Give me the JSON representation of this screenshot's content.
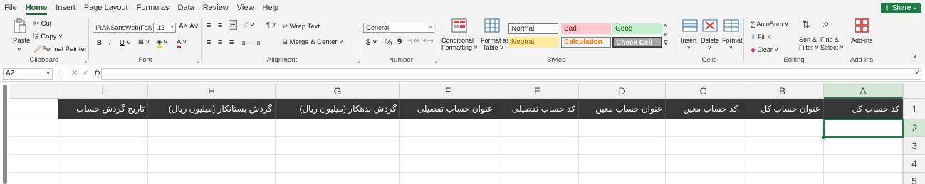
{
  "menu": {
    "items": [
      "File",
      "Home",
      "Insert",
      "Page Layout",
      "Formulas",
      "Data",
      "Review",
      "View",
      "Help"
    ],
    "active": "Home",
    "share_label": "Share"
  },
  "clipboard": {
    "paste": "Paste",
    "cut": "Cut",
    "copy": "Copy",
    "format_painter": "Format Painter",
    "label": "Clipboard"
  },
  "font": {
    "font_name": "IRANSansWeb(FaNu",
    "font_size": "12",
    "label": "Font",
    "bold": "B",
    "italic": "I",
    "underline": "U",
    "grow": "A˄",
    "shrink": "A˅"
  },
  "alignment": {
    "wrap_text": "Wrap Text",
    "merge_center": "Merge & Center",
    "label": "Alignment"
  },
  "number": {
    "format": "General",
    "currency": "$",
    "percent": "%",
    "comma": "9",
    "label": "Number"
  },
  "styles": {
    "conditional": "Conditional",
    "formatting": "Formatting",
    "format_as": "Format as",
    "table": "Table",
    "normal": "Normal",
    "bad": "Bad",
    "good": "Good",
    "neutral": "Neutral",
    "calculation": "Calculation",
    "check_cell": "Check Cell",
    "label": "Styles"
  },
  "cells": {
    "insert": "Insert",
    "delete": "Delete",
    "format": "Format",
    "label": "Cells"
  },
  "editing": {
    "autosum": "AutoSum",
    "fill": "Fill",
    "clear": "Clear",
    "sort_filter_1": "Sort &",
    "sort_filter_2": "Filter",
    "find_select_1": "Find &",
    "find_select_2": "Select",
    "label": "Editing"
  },
  "addins": {
    "button": "Add-ins",
    "label": "Add-ins"
  },
  "formula_bar": {
    "name_box": "A2",
    "fx": "fx",
    "formula": ""
  },
  "sheet": {
    "columns": [
      "A",
      "B",
      "C",
      "D",
      "E",
      "F",
      "G",
      "H",
      "I"
    ],
    "selected_column": "A",
    "rows": [
      "1",
      "2",
      "3",
      "4",
      "5"
    ],
    "selected_row": "2",
    "header_row": [
      "کد حساب کل",
      "عنوان حساب کل",
      "کد حساب معین",
      "عنوان حساب معین",
      "کد حساب تفصیلی",
      "عنوان حساب تفصیلی",
      "گردش بدهکار (میلیون ریال)",
      "گردش بستانکار (میلیون ریال)",
      "تاریخ گردش حساب"
    ]
  }
}
